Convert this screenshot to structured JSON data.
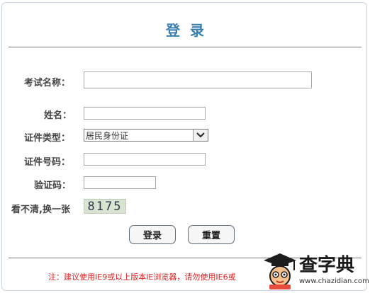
{
  "page": {
    "title": "登录"
  },
  "form": {
    "exam_name_label": "考试名称：",
    "exam_name_value": "",
    "name_label": "姓名：",
    "name_value": "",
    "id_type_label": "证件类型：",
    "id_type_selected": "居民身份证",
    "id_number_label": "证件号码：",
    "id_number_value": "",
    "captcha_label": "验证码：",
    "captcha_value": "",
    "refresh_text": "看不清,换一张",
    "captcha_image_text": "8175"
  },
  "buttons": {
    "login": "登录",
    "reset": "重置"
  },
  "notice": "注：建议使用IE9或以上版本IE浏览器，请勿使用IE6或",
  "watermark": {
    "text": "查字典",
    "url": "www.chazidian.com"
  }
}
